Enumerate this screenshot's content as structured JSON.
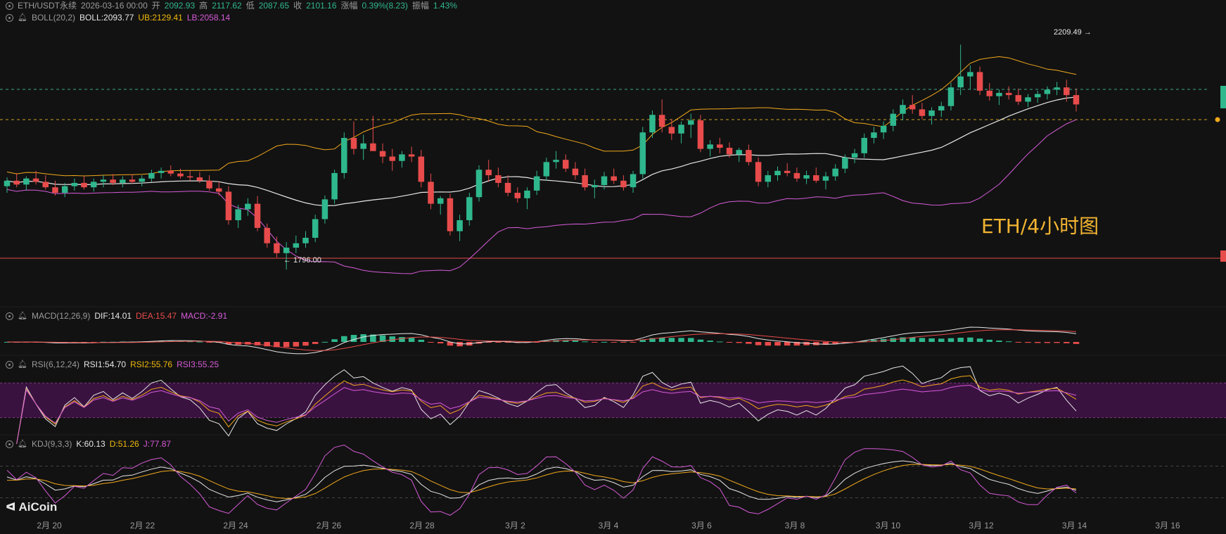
{
  "ohlc_line": {
    "symbol": "ETH/USDT永续",
    "time": "2026-03-16 00:00",
    "open_label": "开",
    "open": "2092.93",
    "high_label": "高",
    "high": "2117.62",
    "low_label": "低",
    "low": "2087.65",
    "close_label": "收",
    "close": "2101.16",
    "change_label": "涨幅",
    "change": "0.39%(8.23)",
    "amp_label": "振幅",
    "amp": "1.43%"
  },
  "boll": {
    "name": "BOLL(20,2)",
    "boll": "BOLL:2093.77",
    "ub": "UB:2129.41",
    "lb": "LB:2058.14"
  },
  "macd": {
    "name": "MACD(12,26,9)",
    "dif": "DIF:14.01",
    "dea": "DEA:15.47",
    "macd": "MACD:-2.91"
  },
  "rsi": {
    "name": "RSI(6,12,24)",
    "rsi1": "RSI1:54.70",
    "rsi2": "RSI2:55.76",
    "rsi3": "RSI3:55.25"
  },
  "kdj": {
    "name": "KDJ(9,3,3)",
    "k": "K:60.13",
    "d": "D:51.26",
    "j": "J:77.87"
  },
  "watermark": "ETH/4小时图",
  "logo": "AiCoin",
  "high_marker": "2209.49 →",
  "low_marker": "← 1796.00",
  "colors": {
    "up": "#2fb78d",
    "down": "#e84b4b",
    "ub": "#f0a81c",
    "mid": "#e6e6e6",
    "lb": "#d65bd8",
    "background": "#121212",
    "rsi_band": "#3a1240"
  },
  "chart_data": {
    "type": "candlestick",
    "timeframe": "4h",
    "x_tick_labels": [
      "2月 20",
      "2月 22",
      "2月 24",
      "2月 26",
      "2月 28",
      "3月 2",
      "3月 4",
      "3月 6",
      "3月 8",
      "3月 10",
      "3月 12",
      "3月 14",
      "3月 16"
    ],
    "high_annotation": 2209.49,
    "low_annotation": 1796.0,
    "candles_ohlc": [
      [
        1952,
        1968,
        1940,
        1962
      ],
      [
        1962,
        1976,
        1950,
        1955
      ],
      [
        1955,
        1970,
        1944,
        1966
      ],
      [
        1966,
        1980,
        1955,
        1960
      ],
      [
        1960,
        1972,
        1946,
        1950
      ],
      [
        1950,
        1962,
        1935,
        1940
      ],
      [
        1940,
        1958,
        1932,
        1952
      ],
      [
        1952,
        1966,
        1944,
        1958
      ],
      [
        1958,
        1970,
        1946,
        1950
      ],
      [
        1950,
        1966,
        1942,
        1960
      ],
      [
        1960,
        1972,
        1950,
        1964
      ],
      [
        1964,
        1974,
        1954,
        1958
      ],
      [
        1958,
        1970,
        1950,
        1964
      ],
      [
        1964,
        1974,
        1956,
        1960
      ],
      [
        1960,
        1972,
        1952,
        1966
      ],
      [
        1966,
        1982,
        1960,
        1976
      ],
      [
        1976,
        1986,
        1966,
        1980
      ],
      [
        1980,
        1990,
        1970,
        1975
      ],
      [
        1975,
        1984,
        1966,
        1970
      ],
      [
        1970,
        1980,
        1962,
        1968
      ],
      [
        1968,
        1978,
        1958,
        1962
      ],
      [
        1962,
        1972,
        1944,
        1948
      ],
      [
        1948,
        1960,
        1935,
        1942
      ],
      [
        1942,
        1952,
        1882,
        1890
      ],
      [
        1890,
        1918,
        1876,
        1910
      ],
      [
        1910,
        1930,
        1898,
        1920
      ],
      [
        1920,
        1934,
        1870,
        1876
      ],
      [
        1876,
        1884,
        1840,
        1848
      ],
      [
        1848,
        1860,
        1822,
        1830
      ],
      [
        1830,
        1850,
        1800,
        1840
      ],
      [
        1840,
        1862,
        1830,
        1848
      ],
      [
        1848,
        1870,
        1840,
        1858
      ],
      [
        1858,
        1900,
        1850,
        1892
      ],
      [
        1892,
        1935,
        1884,
        1928
      ],
      [
        1928,
        1982,
        1920,
        1976
      ],
      [
        1976,
        2050,
        1966,
        2040
      ],
      [
        2040,
        2070,
        2010,
        2020
      ],
      [
        2020,
        2046,
        2000,
        2030
      ],
      [
        2030,
        2080,
        2018,
        2016
      ],
      [
        2016,
        2030,
        1994,
        2006
      ],
      [
        2006,
        2020,
        1980,
        1998
      ],
      [
        1998,
        2016,
        1986,
        2010
      ],
      [
        2010,
        2024,
        1996,
        2006
      ],
      [
        2006,
        2018,
        1950,
        1960
      ],
      [
        1960,
        1975,
        1910,
        1920
      ],
      [
        1920,
        1934,
        1900,
        1930
      ],
      [
        1930,
        1938,
        1862,
        1870
      ],
      [
        1870,
        1900,
        1852,
        1890
      ],
      [
        1890,
        1940,
        1880,
        1932
      ],
      [
        1932,
        1990,
        1924,
        1982
      ],
      [
        1982,
        2000,
        1960,
        1972
      ],
      [
        1972,
        1986,
        1950,
        1958
      ],
      [
        1958,
        1972,
        1934,
        1940
      ],
      [
        1940,
        1950,
        1922,
        1930
      ],
      [
        1930,
        1950,
        1910,
        1944
      ],
      [
        1944,
        1980,
        1936,
        1970
      ],
      [
        1970,
        2004,
        1962,
        1996
      ],
      [
        1996,
        2016,
        1984,
        2000
      ],
      [
        2000,
        2010,
        1978,
        1984
      ],
      [
        1984,
        1996,
        1964,
        1972
      ],
      [
        1972,
        1984,
        1944,
        1950
      ],
      [
        1950,
        1964,
        1930,
        1954
      ],
      [
        1954,
        1978,
        1946,
        1970
      ],
      [
        1970,
        1984,
        1956,
        1962
      ],
      [
        1962,
        1972,
        1944,
        1950
      ],
      [
        1950,
        1980,
        1940,
        1974
      ],
      [
        1974,
        2060,
        1966,
        2050
      ],
      [
        2050,
        2090,
        2040,
        2082
      ],
      [
        2082,
        2110,
        2050,
        2060
      ],
      [
        2060,
        2074,
        2036,
        2048
      ],
      [
        2048,
        2070,
        2030,
        2064
      ],
      [
        2064,
        2084,
        2040,
        2072
      ],
      [
        2072,
        2082,
        2014,
        2020
      ],
      [
        2020,
        2036,
        2006,
        2028
      ],
      [
        2028,
        2040,
        2012,
        2022
      ],
      [
        2022,
        2032,
        2004,
        2010
      ],
      [
        2010,
        2022,
        1996,
        2018
      ],
      [
        2018,
        2028,
        1990,
        1996
      ],
      [
        1996,
        2004,
        1952,
        1960
      ],
      [
        1960,
        1980,
        1950,
        1972
      ],
      [
        1972,
        1988,
        1962,
        1980
      ],
      [
        1980,
        1994,
        1970,
        1976
      ],
      [
        1976,
        1986,
        1960,
        1966
      ],
      [
        1966,
        1980,
        1956,
        1972
      ],
      [
        1972,
        1986,
        1958,
        1962
      ],
      [
        1962,
        1978,
        1946,
        1970
      ],
      [
        1970,
        1992,
        1962,
        1984
      ],
      [
        1984,
        2010,
        1976,
        2004
      ],
      [
        2004,
        2020,
        1994,
        2012
      ],
      [
        2012,
        2048,
        2004,
        2040
      ],
      [
        2040,
        2060,
        2030,
        2050
      ],
      [
        2050,
        2070,
        2038,
        2062
      ],
      [
        2062,
        2092,
        2052,
        2084
      ],
      [
        2084,
        2110,
        2072,
        2100
      ],
      [
        2100,
        2118,
        2084,
        2092
      ],
      [
        2092,
        2104,
        2074,
        2080
      ],
      [
        2080,
        2096,
        2064,
        2090
      ],
      [
        2090,
        2106,
        2078,
        2098
      ],
      [
        2098,
        2140,
        2090,
        2132
      ],
      [
        2132,
        2210,
        2118,
        2152
      ],
      [
        2152,
        2172,
        2128,
        2160
      ],
      [
        2160,
        2170,
        2118,
        2126
      ],
      [
        2126,
        2140,
        2108,
        2116
      ],
      [
        2116,
        2128,
        2100,
        2122
      ],
      [
        2122,
        2134,
        2110,
        2118
      ],
      [
        2118,
        2130,
        2100,
        2106
      ],
      [
        2106,
        2120,
        2096,
        2114
      ],
      [
        2114,
        2126,
        2104,
        2120
      ],
      [
        2120,
        2134,
        2110,
        2128
      ],
      [
        2128,
        2142,
        2118,
        2132
      ],
      [
        2132,
        2146,
        2106,
        2118
      ],
      [
        2118,
        2130,
        2088,
        2101
      ]
    ],
    "ylim": [
      1740,
      2240
    ]
  }
}
